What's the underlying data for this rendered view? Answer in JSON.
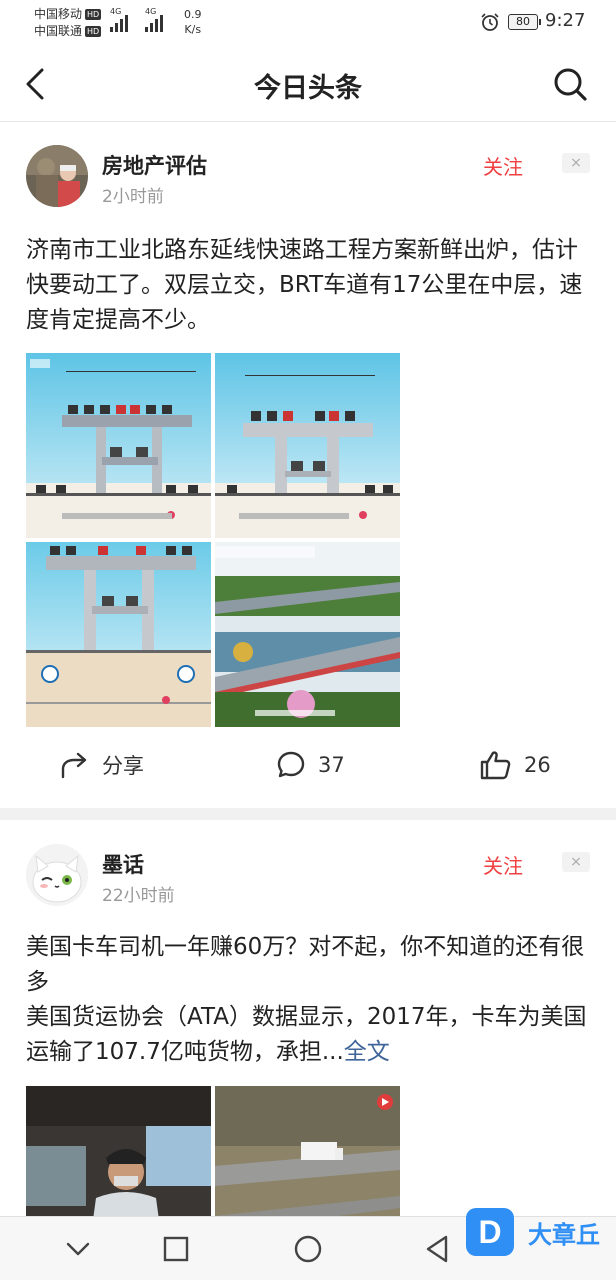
{
  "status": {
    "carrier1": "中国移动",
    "carrier2": "中国联通",
    "hd": "HD",
    "signal_label": "4G",
    "speed_value": "0.9",
    "speed_unit": "K/s",
    "battery": "80",
    "time": "9:27"
  },
  "header": {
    "title": "今日头条"
  },
  "posts": [
    {
      "author": "房地产评估",
      "time": "2小时前",
      "follow_label": "关注",
      "close_label": "×",
      "text": "济南市工业北路东延线快速路工程方案新鲜出炉，估计快要动工了。双层立交，BRT车道有17公里在中层，速度肯定提高不少。",
      "share_label": "分享",
      "comments": "37",
      "likes": "26"
    },
    {
      "author": "墨话",
      "time": "22小时前",
      "follow_label": "关注",
      "close_label": "×",
      "text_line1": "美国卡车司机一年赚60万？对不起，你不知道的还有很多",
      "text_line2": "美国货运协会（ATA）数据显示，2017年，卡车为美国运输了107.7亿吨货物，承担...",
      "more_label": "全文"
    }
  ],
  "overlay": {
    "badge_logo": "D",
    "badge_text": "大章丘"
  },
  "colors": {
    "accent_red": "#f04142",
    "link_blue": "#406599",
    "badge_blue": "#2f8ff5"
  }
}
